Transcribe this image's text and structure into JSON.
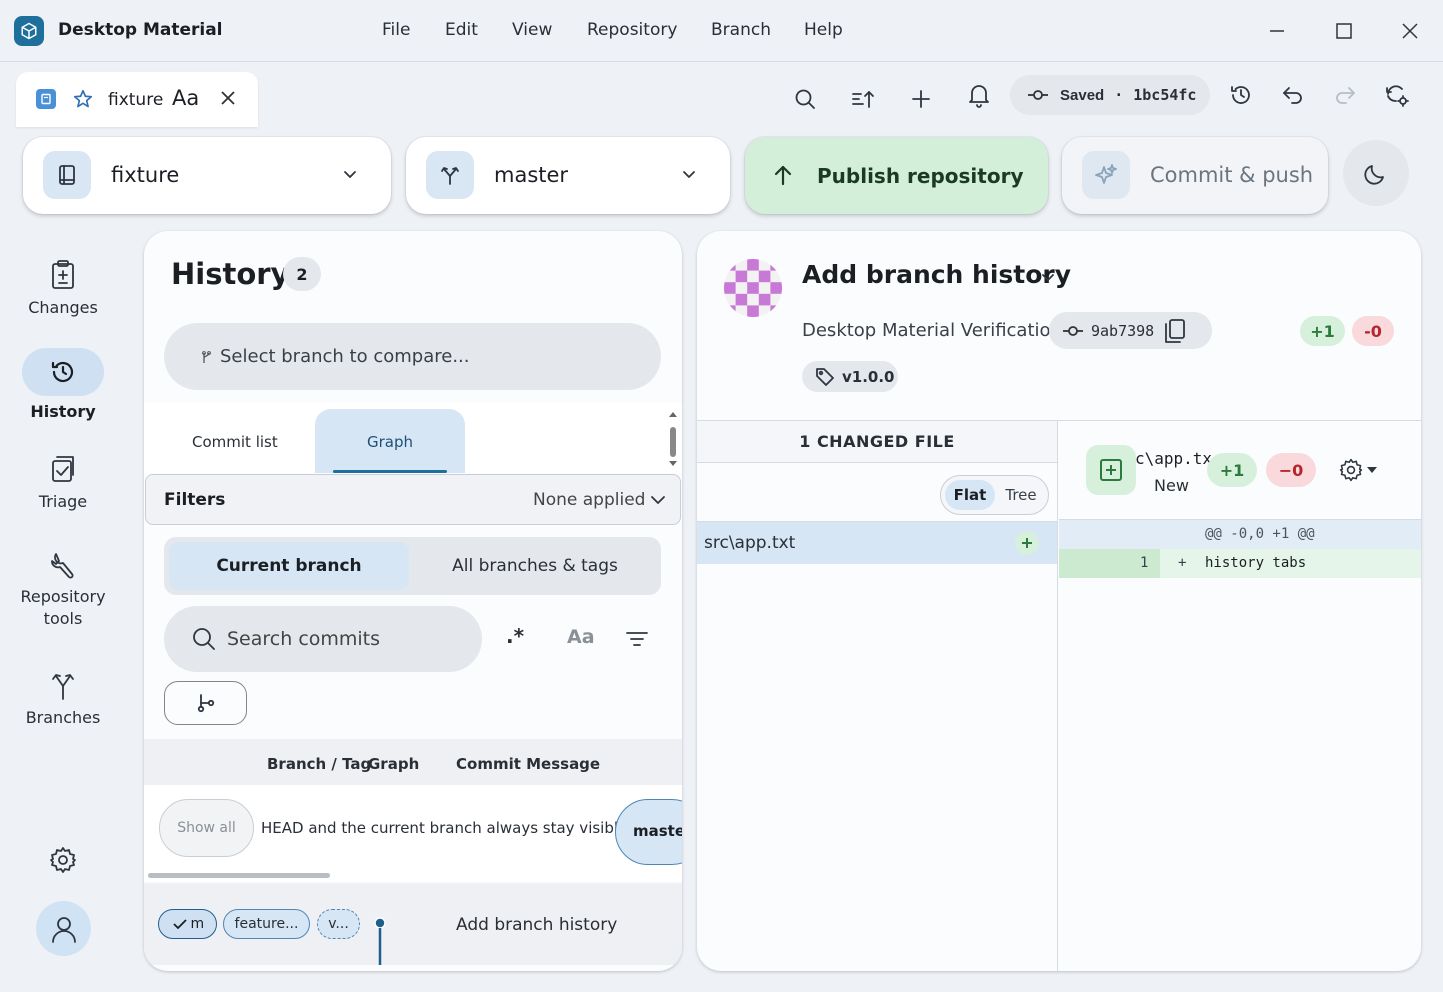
{
  "app": {
    "title": "Desktop Material"
  },
  "menu": [
    "File",
    "Edit",
    "View",
    "Repository",
    "Branch",
    "Help"
  ],
  "tab": {
    "label": "fixture",
    "case_glyph": "Aa"
  },
  "status": {
    "saved_label": "Saved",
    "separator": "·",
    "commit": "1bc54fc"
  },
  "toolbar": {
    "repository": "fixture",
    "branch": "master",
    "publish": "Publish repository",
    "commit_push": "Commit & push"
  },
  "nav": {
    "changes": "Changes",
    "history": "History",
    "triage": "Triage",
    "repo_tools_line1": "Repository",
    "repo_tools_line2": "tools",
    "branches": "Branches"
  },
  "history": {
    "title": "History",
    "count": "2",
    "compare_placeholder": "Select branch to compare...",
    "tabs": [
      "Commit list",
      "Graph"
    ],
    "filters_label": "Filters",
    "filters_value": "None applied",
    "scope": [
      "Current branch",
      "All branches & tags"
    ],
    "search_placeholder": "Search commits",
    "regex_glyph": ".*",
    "case_glyph": "Aa",
    "columns": {
      "branch_tag": "Branch / Tag",
      "graph": "Graph",
      "message": "Commit Message"
    },
    "show_all": "Show all",
    "visibility_note": "HEAD and the current branch always stay visible.",
    "master_chip": "master",
    "row": {
      "ref1": "m",
      "ref2": "feature...",
      "ref3": "v...",
      "message": "Add branch history"
    }
  },
  "commit": {
    "title": "Add branch history",
    "author": "Desktop Material Verification",
    "sha": "9ab7398",
    "tag": "v1.0.0",
    "added": "+1",
    "removed": "-0",
    "changed_files_header": "1 CHANGED FILE",
    "view_modes": [
      "Flat",
      "Tree"
    ],
    "file_path": "src\\app.txt",
    "diff": {
      "file_name": "c\\app.tx",
      "status": "New",
      "added": "+1",
      "removed": "−0",
      "hunk": "@@ -0,0 +1 @@",
      "line_no": "1",
      "line_sign": "+",
      "line_text": "history tabs"
    }
  },
  "colors": {
    "accent": "#1f6f9c",
    "publish_bg": "#d3efd9",
    "added_bg": "#d7f0dc",
    "added_fg": "#2c7a3d",
    "removed_bg": "#f9d9dc",
    "removed_fg": "#b4262f",
    "selected_bg": "#d6e6f5"
  }
}
